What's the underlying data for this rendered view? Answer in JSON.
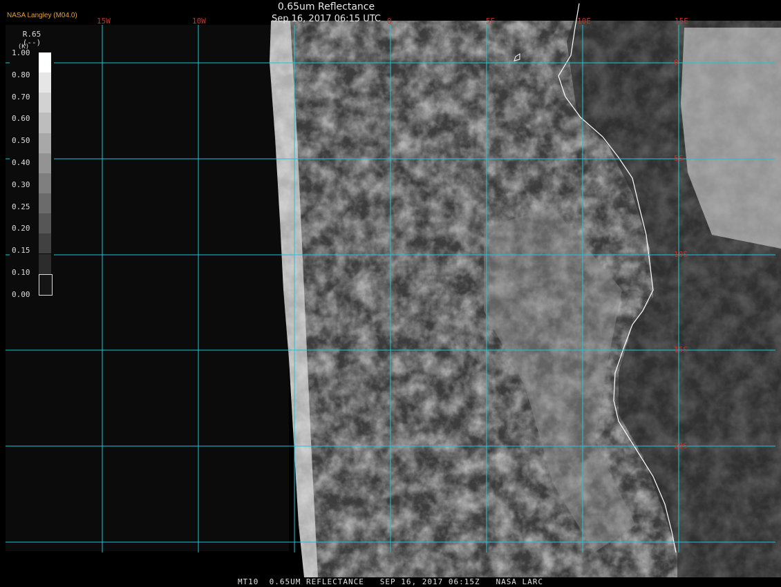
{
  "header": {
    "title": "0.65um Reflectance",
    "datetime": "Sep 16, 2017 06:15 UTC",
    "credit": "NASA Langley (M04.0)"
  },
  "footer": {
    "text": "MT10  0.65UM REFLECTANCE   SEP 16, 2017 06:15Z   NASA LARC"
  },
  "legend": {
    "title": "R.65",
    "units": "(--)",
    "subtitle": "(K)",
    "ticks": [
      "1.00",
      "0.80",
      "0.70",
      "0.60",
      "0.50",
      "0.40",
      "0.30",
      "0.25",
      "0.20",
      "0.15",
      "0.10",
      "0.00"
    ],
    "swatch_colors": [
      "#ffffff",
      "#e6e6e6",
      "#d2d2d2",
      "#bdbdbd",
      "#a8a8a8",
      "#939393",
      "#7f7f7f",
      "#6b6b6b",
      "#565656",
      "#414141",
      "#2c2c2c",
      "#151515"
    ]
  },
  "grid": {
    "longitudes": [
      "15W",
      "10W",
      "0",
      "5E",
      "10E",
      "15E"
    ],
    "latitudes": [
      "0",
      "5S",
      "10S",
      "15S",
      "20S"
    ],
    "line_color": "#19c7d1",
    "label_color": "#c8322a"
  },
  "colors": {
    "background": "#000000",
    "space": "#0b0b0b",
    "coastline": "#ffffff"
  }
}
